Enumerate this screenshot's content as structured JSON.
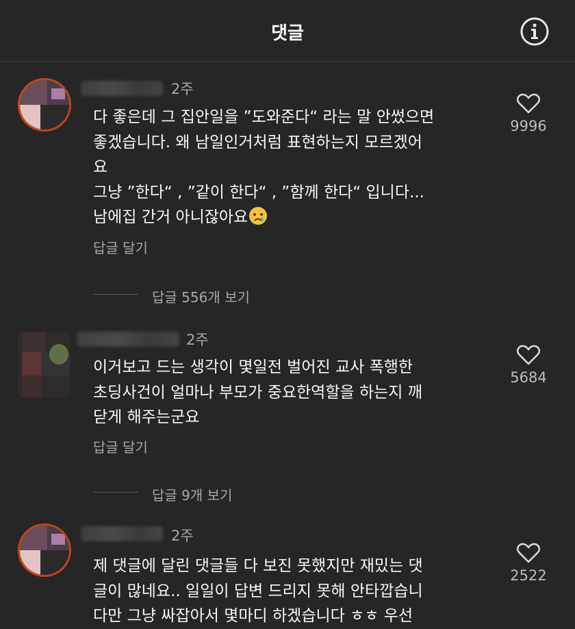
{
  "header": {
    "title": "댓글",
    "info_icon": "info-icon"
  },
  "comments": [
    {
      "time": "2주",
      "text_lines": [
        "다 좋은데 그 집안일을 ”도와준다“ 라는 말 안썼으면",
        "좋겠습니다. 왜 남일인거처럼 표현하는지 모르겠어",
        "요",
        "그냥 ”한다“ , ”같이 한다“ , ”함께 한다“ 입니다...",
        "남에집 간거 아니잖아요"
      ],
      "emoji": "crying-face",
      "reply_label": "답글 달기",
      "view_replies": "답글 556개 보기",
      "likes": "9996"
    },
    {
      "time": "2주",
      "text_lines": [
        "이거보고 드는 생각이 몇일전 벌어진 교사 폭행한",
        "초딩사건이 얼마나 부모가 중요한역할을 하는지 깨",
        "닫게 해주는군요"
      ],
      "reply_label": "답글 달기",
      "view_replies": "답글 9개 보기",
      "likes": "5684"
    },
    {
      "time": "2주",
      "text_lines": [
        "제 댓글에 달린 댓글들 다 보진 못했지만 재밌는 댓",
        "글이 많네요.. 일일이 답변 드리지 못해 안타깝습니",
        "다만 그냥 싸잡아서 몇마디 하겠습니다 ㅎㅎ 우선"
      ],
      "likes": "2522"
    }
  ],
  "colors": {
    "background": "#262626",
    "text": "#f7f7f7",
    "muted": "#a8a8a8",
    "ring": "#c8431a"
  }
}
